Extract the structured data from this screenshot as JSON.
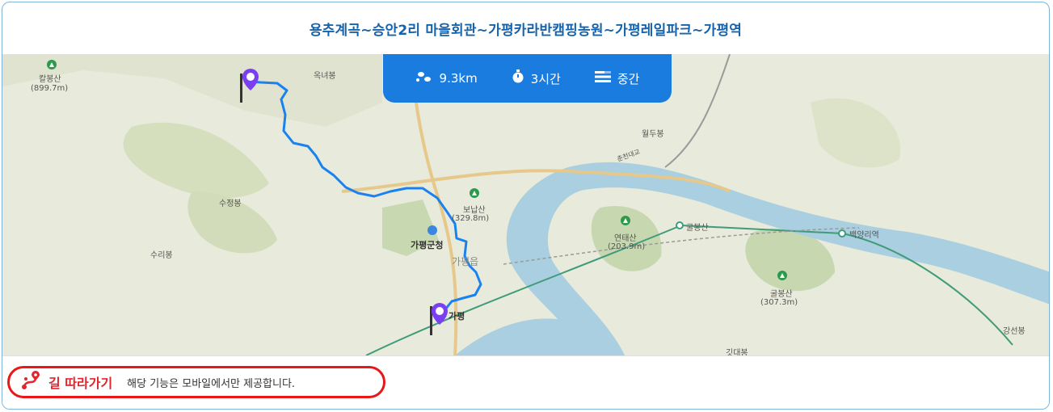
{
  "title": "용추계곡~승안2리 마을회관~가평카라반캠핑농원~가평레일파크~가평역",
  "stats": {
    "distance": "9.3km",
    "time": "3시간",
    "difficulty": "중간",
    "distance_icon": "footsteps-icon",
    "time_icon": "stopwatch-icon",
    "difficulty_icon": "level-bars-icon"
  },
  "map": {
    "labels": {
      "kalbongsan": "칼봉산",
      "kalbongsan_height": "(899.7m)",
      "oknyeobong": "옥녀봉",
      "sujeongbong": "수정봉",
      "suribong": "수리봉",
      "bonansan": "보납산",
      "bonansan_height": "(329.8m)",
      "gapyeong_county": "가평군청",
      "gapyeong_eup": "가평읍",
      "gapyeong": "가평",
      "woldubong": "월두봉",
      "yeontaesan": "연태산",
      "yeontaesan_height": "(203.9m)",
      "gulbongsan_station": "굴봉산",
      "baegyangri_station": "백양리역",
      "gulbongsan": "굴봉산",
      "gulbongsan_height": "(307.3m)",
      "gangseonbong": "강선봉",
      "gitdaebong": "깃대봉",
      "bridge": "춘천대교"
    },
    "route_color": "#1a82f0",
    "river_color": "#a9cfe0",
    "marker_color": "#7a3ff2"
  },
  "footer": {
    "follow_label": "길 따라가기",
    "follow_icon": "route-pin-icon",
    "note": "해당 기능은 모바일에서만 제공합니다."
  }
}
